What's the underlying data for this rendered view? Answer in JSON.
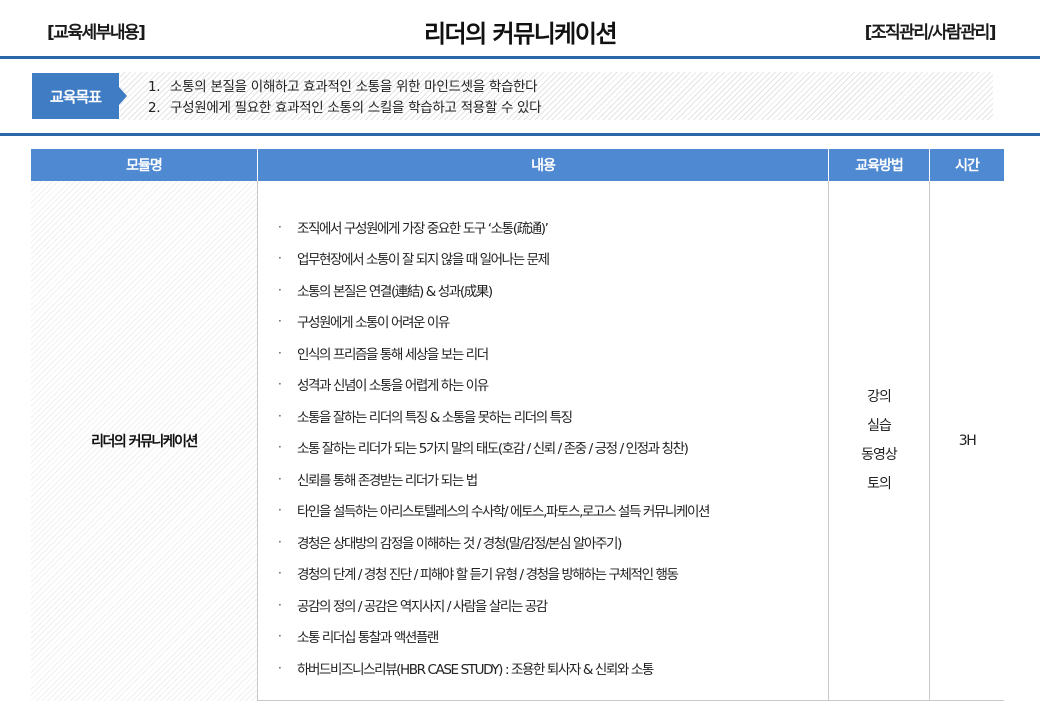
{
  "header": {
    "left_tag": "[교육세부내용]",
    "title": "리더의 커뮤니케이션",
    "right_tag": "[조직관리/사람관리]"
  },
  "goal": {
    "badge": "교육목표",
    "items": [
      {
        "num": "1.",
        "text": "소통의 본질을 이해하고 효과적인 소통을 위한 마인드셋을 학습한다"
      },
      {
        "num": "2.",
        "text": "구성원에게 필요한 효과적인 소통의 스킬을 학습하고 적용할 수 있다"
      }
    ]
  },
  "table": {
    "headers": [
      "모듈명",
      "내용",
      "교육방법",
      "시간"
    ],
    "module_name": "리더의 커뮤니케이션",
    "bullet": "·",
    "contents": [
      "조직에서 구성원에게 가장 중요한 도구 ‘소통(疏通)’",
      "업무현장에서 소통이 잘 되지 않을 때 일어나는 문제",
      "소통의 본질은 연결(連結) & 성과(成果)",
      "구성원에게 소통이 어려운 이유",
      "인식의 프리즘을 통해 세상을 보는 리더",
      "성격과 신념이 소통을 어렵게 하는 이유",
      "소통을 잘하는 리더의 특징 & 소통을 못하는 리더의 특징",
      "소통 잘하는 리더가 되는 5가지 말의 태도(호감 / 신뢰 / 존중 / 긍정 / 인정과 칭찬)",
      "신뢰를 통해 존경받는 리더가 되는 법",
      "타인을 설득하는 아리스토텔레스의 수사학/ 에토스,파토스,로고스 설득 커뮤니케이션",
      "경청은 상대방의 감정을 이해하는 것 / 경청(말/감정/본심 알아주기)",
      "경청의 단계 / 경청 진단 / 피해야 할 듣기 유형 / 경청을 방해하는 구체적인 행동",
      "공감의 정의 / 공감은 역지사지 / 사람을 살리는 공감",
      "소통 리더십 통찰과 액션플랜",
      "하버드비즈니스리뷰(HBR CASE STUDY) : 조용한 퇴사자 & 신뢰와 소통"
    ],
    "methods": [
      "강의",
      "실습",
      "동영상",
      "토의"
    ],
    "time": "3H"
  },
  "colors": {
    "accent_blue": "#2a67a8",
    "header_blue": "#4f89d2",
    "badge_blue": "#3f7cc4"
  }
}
